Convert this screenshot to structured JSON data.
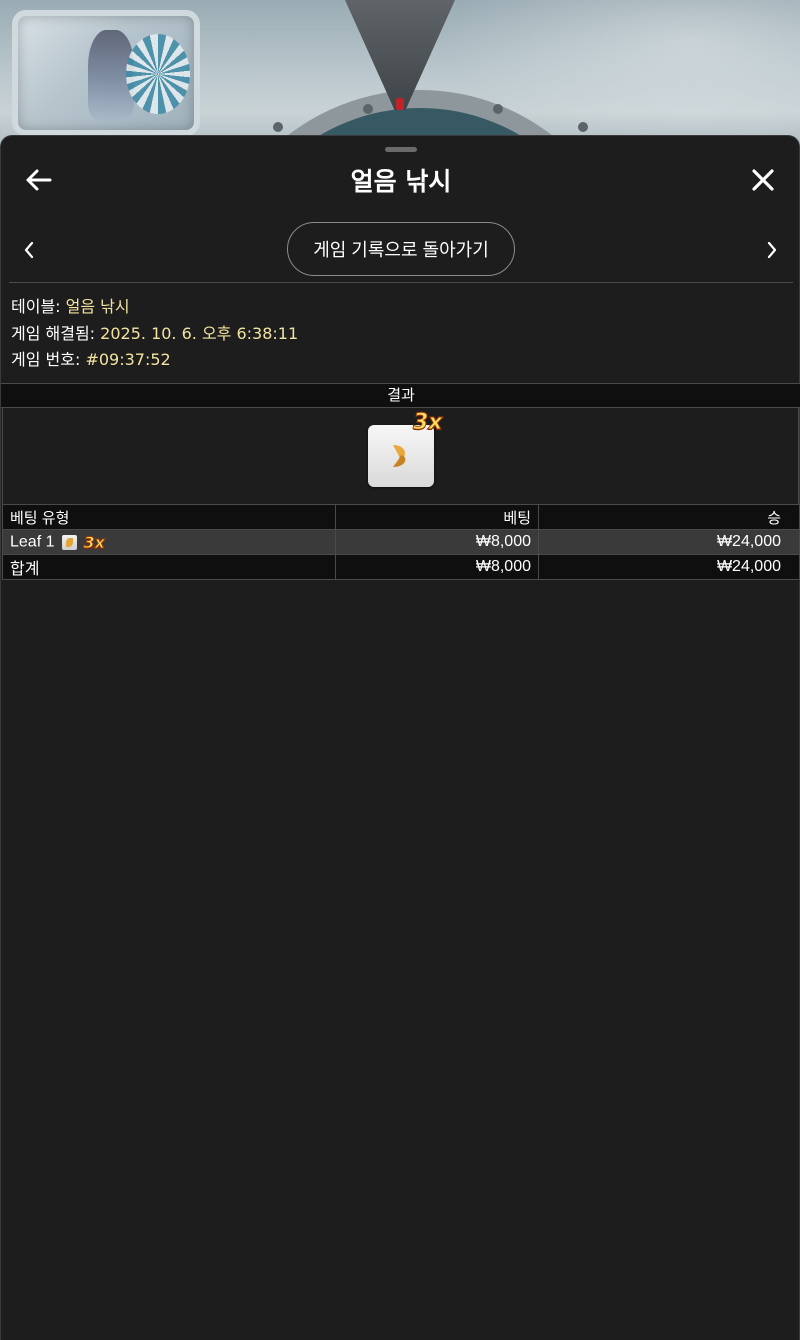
{
  "header": {
    "title": "얼음 낚시",
    "back_icon": "arrow-left-icon",
    "close_icon": "close-icon"
  },
  "navigation": {
    "history_button": "게임 기록으로 돌아가기",
    "prev_icon": "chevron-left-icon",
    "next_icon": "chevron-right-icon"
  },
  "info": {
    "table_label": "테이블:",
    "table_value": "얼음 낚시",
    "resolved_label": "게임 해결됨:",
    "resolved_value": "2025. 10. 6. 오후 6:38:11",
    "game_no_label": "게임 번호:",
    "game_no_value": "#09:37:52"
  },
  "result": {
    "header": "결과",
    "symbol": "leaf-icon",
    "multiplier": "3x"
  },
  "bets_table": {
    "columns": [
      "베팅 유형",
      "베팅",
      "승"
    ],
    "rows": [
      {
        "type": "Leaf 1",
        "multiplier": "3x",
        "bet": "₩8,000",
        "win": "₩24,000"
      }
    ],
    "total": {
      "label": "합계",
      "bet": "₩8,000",
      "win": "₩24,000"
    }
  },
  "colors": {
    "accent_text": "#f3e3a0",
    "sheet_bg": "#1d1d1d",
    "multiplier": "#ffe06b"
  }
}
